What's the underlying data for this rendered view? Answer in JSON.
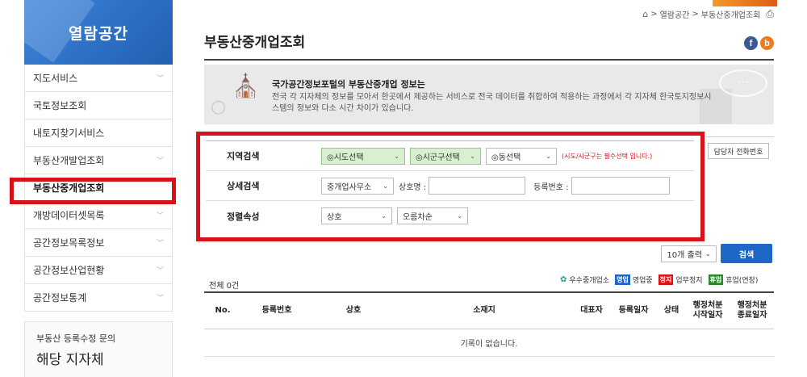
{
  "sidebar": {
    "title": "열람공간",
    "items": [
      {
        "label": "지도서비스",
        "chevron": true
      },
      {
        "label": "국토정보조회",
        "chevron": false
      },
      {
        "label": "내토지찾기서비스",
        "chevron": false
      },
      {
        "label": "부동산개발업조회",
        "chevron": true
      },
      {
        "label": "부동산중개업조회",
        "chevron": false,
        "active": true
      },
      {
        "label": "개방데이터셋목록",
        "chevron": true
      },
      {
        "label": "공간정보목록정보",
        "chevron": true
      },
      {
        "label": "공간정보산업현황",
        "chevron": true
      },
      {
        "label": "공간정보통계",
        "chevron": true
      }
    ],
    "contact_box": {
      "small": "부동산 등록수정 문의",
      "big": "해당 지자체"
    }
  },
  "breadcrumb": {
    "home_icon": "home-icon",
    "sep1": ">",
    "item1": "열람공간",
    "sep2": ">",
    "item2": "부동산중개업조회",
    "print_icon": "printer-icon"
  },
  "page_title": "부동산중개업조회",
  "sns": {
    "facebook": "f",
    "blog": "b"
  },
  "info": {
    "heading": "국가공간정보포털의 부동산중개업 정보는",
    "body": "전국 각 지자체의 정보를 모아서 한곳에서 제공하는 서비스로 전국 데이터를 취합하여 적용하는 과정에서 각 지자체 한국토지정보시스템의 정보와 다소 시간 차이가 있습니다."
  },
  "tel_button": "담당자 전화번호",
  "search": {
    "region": {
      "label": "지역검색",
      "sido": "◎시도선택",
      "sigungu": "◎시군구선택",
      "dong": "◎동선택",
      "note": "(시도/시군구는 필수선택 입니다.)"
    },
    "detail": {
      "label": "상세검색",
      "type": "중개업사무소",
      "name_label": "상호명 :",
      "name_value": "",
      "reg_label": "등록번호 :",
      "reg_value": ""
    },
    "sort": {
      "label": "정렬속성",
      "field": "상호",
      "order": "오름차순"
    }
  },
  "count_select": "10개 출력",
  "search_button": "검색",
  "legend": {
    "excellent": "우수중개업소",
    "op_badge": "영업",
    "op_text": "영업중",
    "stop_badge": "정지",
    "stop_text": "업무정지",
    "rest_badge": "휴업",
    "rest_text": "휴업(연장)"
  },
  "total": "전체 0건",
  "table": {
    "headers": {
      "no": "No.",
      "reg_no": "등록번호",
      "name": "상호",
      "address": "소재지",
      "rep": "대표자",
      "reg_date": "등록일자",
      "status": "상태",
      "disp_start_1": "행정처분",
      "disp_start_2": "시작일자",
      "disp_end_1": "행정처분",
      "disp_end_2": "종료일자"
    },
    "empty_message": "기록이 없습니다."
  },
  "colors": {
    "brand_blue": "#2a6ec4",
    "highlight_red": "#d9121a",
    "button_blue": "#1f67c6",
    "green_select": "#d8f0d0"
  }
}
